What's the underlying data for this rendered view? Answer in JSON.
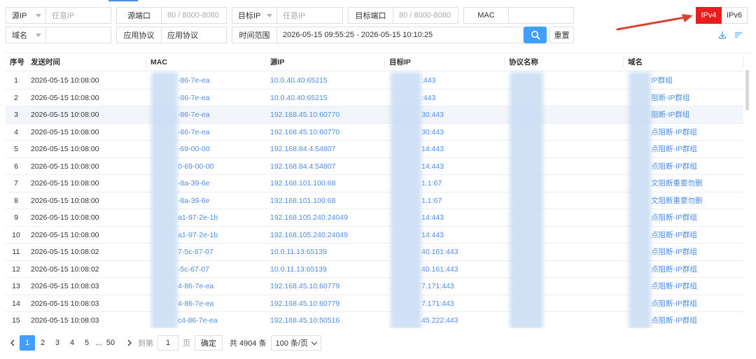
{
  "filters": {
    "src_ip": {
      "select": "源IP",
      "placeholder": "任意IP"
    },
    "src_port": {
      "label": "源端口",
      "placeholder": "80 / 8000-8080"
    },
    "dst_ip": {
      "select": "目标IP",
      "placeholder": "任意IP"
    },
    "dst_port": {
      "label": "目标端口",
      "placeholder": "80 / 8000-8080"
    },
    "mac": {
      "label": "MAC",
      "value": ""
    },
    "domain": {
      "select": "域名",
      "value": ""
    },
    "app_protocol": {
      "label": "应用协议",
      "value": "应用协议"
    },
    "time_range": {
      "label": "时间范围",
      "value": "2026-05-15 09:55:25 - 2026-05-15 10:10:25"
    },
    "reset_label": "重置"
  },
  "ip_toggle": {
    "ipv4": "IPv4",
    "ipv6": "IPv6",
    "active": "IPv4"
  },
  "colors": {
    "primary": "#409eff",
    "active_red": "#ea1c1c",
    "link": "#4e8ee8",
    "arrow": "#d9432f"
  },
  "table": {
    "headers": [
      "序号",
      "发送时间",
      "MAC",
      "源IP",
      "目标IP",
      "协议名称",
      "域名"
    ],
    "rows": [
      {
        "idx": "1",
        "time": "2026-05-15 10:08:00",
        "mac": "-86-7e-ea",
        "src": "10.0.40.40:65215",
        "dst": ":443",
        "proto": "",
        "domain": "IP群组"
      },
      {
        "idx": "2",
        "time": "2026-05-15 10:08:00",
        "mac": "-86-7e-ea",
        "src": "10.0.40.40:65215",
        "dst": ":443",
        "proto": "",
        "domain": "阻断-IP群组"
      },
      {
        "idx": "3",
        "time": "2026-05-15 10:08:00",
        "mac": "-86-7e-ea",
        "src": "192.168.45.10:60770",
        "dst": "30:443",
        "proto": "",
        "domain": "阻断-IP群组"
      },
      {
        "idx": "4",
        "time": "2026-05-15 10:08:00",
        "mac": "-86-7e-ea",
        "src": "192.168.45.10:60770",
        "dst": "30:443",
        "proto": "",
        "domain": "点阻断-IP群组"
      },
      {
        "idx": "5",
        "time": "2026-05-15 10:08:00",
        "mac": "-69-00-00",
        "src": "192.168.84.4:54807",
        "dst": "14:443",
        "proto": "",
        "domain": "点阻断-IP群组"
      },
      {
        "idx": "6",
        "time": "2026-05-15 10:08:00",
        "mac": "0-69-00-00",
        "src": "192.168.84.4:54807",
        "dst": "14:443",
        "proto": "",
        "domain": "点阻断-IP群组"
      },
      {
        "idx": "7",
        "time": "2026-05-15 10:08:00",
        "mac": "-8a-39-6e",
        "src": "192.168.101.100:68",
        "dst": "1.1:67",
        "proto": "",
        "domain": "文阻断重要勿删"
      },
      {
        "idx": "8",
        "time": "2026-05-15 10:08:00",
        "mac": "-8a-39-6e",
        "src": "192.168.101.100:68",
        "dst": "1.1:67",
        "proto": "",
        "domain": "文阻断重要勿删"
      },
      {
        "idx": "9",
        "time": "2026-05-15 10:08:00",
        "mac": "a1-97-2e-1b",
        "src": "192.168.105.240:24049",
        "dst": "14:443",
        "proto": "",
        "domain": "点阻断-IP群组"
      },
      {
        "idx": "10",
        "time": "2026-05-15 10:08:00",
        "mac": "a1-97-2e-1b",
        "src": "192.168.105.240:24049",
        "dst": "14:443",
        "proto": "",
        "domain": "点阻断-IP群组"
      },
      {
        "idx": "11",
        "time": "2026-05-15 10:08:02",
        "mac": "7-5c-67-07",
        "src": "10.0.11.13:65139",
        "dst": "40.161:443",
        "proto": "",
        "domain": "点阻断-IP群组"
      },
      {
        "idx": "12",
        "time": "2026-05-15 10:08:02",
        "mac": "-5c-67-07",
        "src": "10.0.11.13:65139",
        "dst": "40.161:443",
        "proto": "",
        "domain": "点阻断-IP群组"
      },
      {
        "idx": "13",
        "time": "2026-05-15 10:08:03",
        "mac": "4-86-7e-ea",
        "src": "192.168.45.10:60779",
        "dst": "7.171:443",
        "proto": "",
        "domain": "点阻断-IP群组"
      },
      {
        "idx": "14",
        "time": "2026-05-15 10:08:03",
        "mac": "4-86-7e-ea",
        "src": "192.168.45.10:60779",
        "dst": "7.171:443",
        "proto": "",
        "domain": "点阻断-IP群组"
      },
      {
        "idx": "15",
        "time": "2026-05-15 10:08:03",
        "mac": "c4-86-7e-ea",
        "src": "192.168.45.10:50516",
        "dst": "45.222:443",
        "proto": "",
        "domain": "点阻断-IP群组"
      }
    ]
  },
  "pagination": {
    "pages": [
      "1",
      "2",
      "3",
      "4",
      "5",
      "...",
      "50"
    ],
    "active": "1",
    "goto_label": "到第",
    "goto_value": "1",
    "page_unit": "页",
    "confirm": "确定",
    "total": "共 4904 条",
    "page_size": "100 条/页"
  }
}
